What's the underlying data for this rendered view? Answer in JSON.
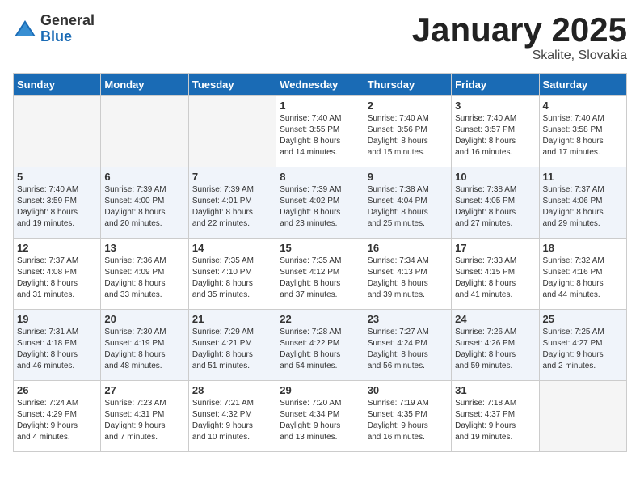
{
  "header": {
    "logo_general": "General",
    "logo_blue": "Blue",
    "month_year": "January 2025",
    "location": "Skalite, Slovakia"
  },
  "days_of_week": [
    "Sunday",
    "Monday",
    "Tuesday",
    "Wednesday",
    "Thursday",
    "Friday",
    "Saturday"
  ],
  "weeks": [
    [
      {
        "day": "",
        "info": ""
      },
      {
        "day": "",
        "info": ""
      },
      {
        "day": "",
        "info": ""
      },
      {
        "day": "1",
        "info": "Sunrise: 7:40 AM\nSunset: 3:55 PM\nDaylight: 8 hours\nand 14 minutes."
      },
      {
        "day": "2",
        "info": "Sunrise: 7:40 AM\nSunset: 3:56 PM\nDaylight: 8 hours\nand 15 minutes."
      },
      {
        "day": "3",
        "info": "Sunrise: 7:40 AM\nSunset: 3:57 PM\nDaylight: 8 hours\nand 16 minutes."
      },
      {
        "day": "4",
        "info": "Sunrise: 7:40 AM\nSunset: 3:58 PM\nDaylight: 8 hours\nand 17 minutes."
      }
    ],
    [
      {
        "day": "5",
        "info": "Sunrise: 7:40 AM\nSunset: 3:59 PM\nDaylight: 8 hours\nand 19 minutes."
      },
      {
        "day": "6",
        "info": "Sunrise: 7:39 AM\nSunset: 4:00 PM\nDaylight: 8 hours\nand 20 minutes."
      },
      {
        "day": "7",
        "info": "Sunrise: 7:39 AM\nSunset: 4:01 PM\nDaylight: 8 hours\nand 22 minutes."
      },
      {
        "day": "8",
        "info": "Sunrise: 7:39 AM\nSunset: 4:02 PM\nDaylight: 8 hours\nand 23 minutes."
      },
      {
        "day": "9",
        "info": "Sunrise: 7:38 AM\nSunset: 4:04 PM\nDaylight: 8 hours\nand 25 minutes."
      },
      {
        "day": "10",
        "info": "Sunrise: 7:38 AM\nSunset: 4:05 PM\nDaylight: 8 hours\nand 27 minutes."
      },
      {
        "day": "11",
        "info": "Sunrise: 7:37 AM\nSunset: 4:06 PM\nDaylight: 8 hours\nand 29 minutes."
      }
    ],
    [
      {
        "day": "12",
        "info": "Sunrise: 7:37 AM\nSunset: 4:08 PM\nDaylight: 8 hours\nand 31 minutes."
      },
      {
        "day": "13",
        "info": "Sunrise: 7:36 AM\nSunset: 4:09 PM\nDaylight: 8 hours\nand 33 minutes."
      },
      {
        "day": "14",
        "info": "Sunrise: 7:35 AM\nSunset: 4:10 PM\nDaylight: 8 hours\nand 35 minutes."
      },
      {
        "day": "15",
        "info": "Sunrise: 7:35 AM\nSunset: 4:12 PM\nDaylight: 8 hours\nand 37 minutes."
      },
      {
        "day": "16",
        "info": "Sunrise: 7:34 AM\nSunset: 4:13 PM\nDaylight: 8 hours\nand 39 minutes."
      },
      {
        "day": "17",
        "info": "Sunrise: 7:33 AM\nSunset: 4:15 PM\nDaylight: 8 hours\nand 41 minutes."
      },
      {
        "day": "18",
        "info": "Sunrise: 7:32 AM\nSunset: 4:16 PM\nDaylight: 8 hours\nand 44 minutes."
      }
    ],
    [
      {
        "day": "19",
        "info": "Sunrise: 7:31 AM\nSunset: 4:18 PM\nDaylight: 8 hours\nand 46 minutes."
      },
      {
        "day": "20",
        "info": "Sunrise: 7:30 AM\nSunset: 4:19 PM\nDaylight: 8 hours\nand 48 minutes."
      },
      {
        "day": "21",
        "info": "Sunrise: 7:29 AM\nSunset: 4:21 PM\nDaylight: 8 hours\nand 51 minutes."
      },
      {
        "day": "22",
        "info": "Sunrise: 7:28 AM\nSunset: 4:22 PM\nDaylight: 8 hours\nand 54 minutes."
      },
      {
        "day": "23",
        "info": "Sunrise: 7:27 AM\nSunset: 4:24 PM\nDaylight: 8 hours\nand 56 minutes."
      },
      {
        "day": "24",
        "info": "Sunrise: 7:26 AM\nSunset: 4:26 PM\nDaylight: 8 hours\nand 59 minutes."
      },
      {
        "day": "25",
        "info": "Sunrise: 7:25 AM\nSunset: 4:27 PM\nDaylight: 9 hours\nand 2 minutes."
      }
    ],
    [
      {
        "day": "26",
        "info": "Sunrise: 7:24 AM\nSunset: 4:29 PM\nDaylight: 9 hours\nand 4 minutes."
      },
      {
        "day": "27",
        "info": "Sunrise: 7:23 AM\nSunset: 4:31 PM\nDaylight: 9 hours\nand 7 minutes."
      },
      {
        "day": "28",
        "info": "Sunrise: 7:21 AM\nSunset: 4:32 PM\nDaylight: 9 hours\nand 10 minutes."
      },
      {
        "day": "29",
        "info": "Sunrise: 7:20 AM\nSunset: 4:34 PM\nDaylight: 9 hours\nand 13 minutes."
      },
      {
        "day": "30",
        "info": "Sunrise: 7:19 AM\nSunset: 4:35 PM\nDaylight: 9 hours\nand 16 minutes."
      },
      {
        "day": "31",
        "info": "Sunrise: 7:18 AM\nSunset: 4:37 PM\nDaylight: 9 hours\nand 19 minutes."
      },
      {
        "day": "",
        "info": ""
      }
    ]
  ]
}
